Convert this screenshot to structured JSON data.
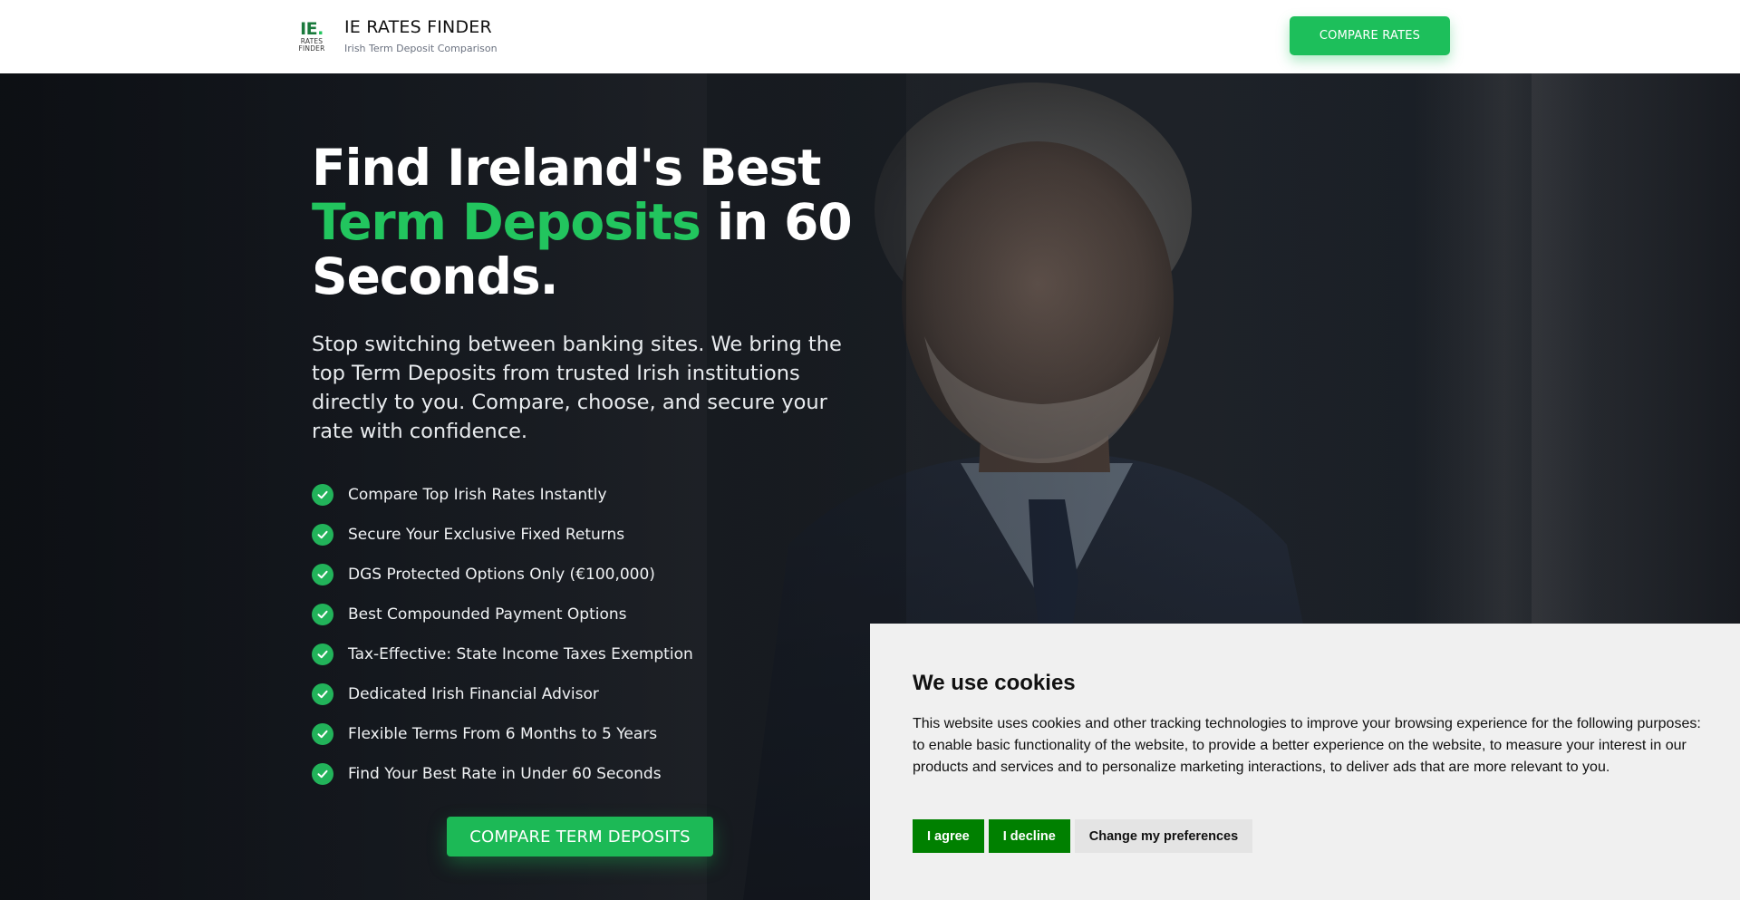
{
  "header": {
    "logo": {
      "mark": "IE",
      "dot": ".",
      "line1": "RATES",
      "line2": "FINDER"
    },
    "brand_title": "IE RATES FINDER",
    "brand_subtitle": "Irish Term Deposit Comparison",
    "cta_label": "COMPARE RATES"
  },
  "hero": {
    "title_part1": "Find Ireland's Best",
    "title_accent": "Term Deposits",
    "title_part2": "in 60",
    "title_part3": "Seconds.",
    "description": "Stop switching between banking sites. We bring the top Term Deposits from trusted Irish institutions directly to you. Compare, choose, and secure your rate with confidence.",
    "features": [
      "Compare Top Irish Rates Instantly",
      "Secure Your Exclusive Fixed Returns",
      "DGS Protected Options Only (€100,000)",
      "Best Compounded Payment Options",
      "Tax-Effective: State Income Taxes Exemption",
      "Dedicated Irish Financial Advisor",
      "Flexible Terms From 6 Months to 5 Years",
      "Find Your Best Rate in Under 60 Seconds"
    ],
    "cta_label": "COMPARE TERM DEPOSITS"
  },
  "cookie": {
    "title": "We use cookies",
    "text": "This website uses cookies and other tracking technologies to improve your browsing experience for the following purposes: to enable basic functionality of the website, to provide a better experience on the website, to measure your interest in our products and services and to personalize marketing interactions, to deliver ads that are more relevant to you.",
    "agree_label": "I agree",
    "decline_label": "I decline",
    "preferences_label": "Change my preferences"
  },
  "colors": {
    "accent_green": "#22c55e",
    "button_green": "#1dbf5b",
    "cookie_green": "#008000"
  },
  "icons": {
    "feature_icon": "check-circle-icon"
  }
}
